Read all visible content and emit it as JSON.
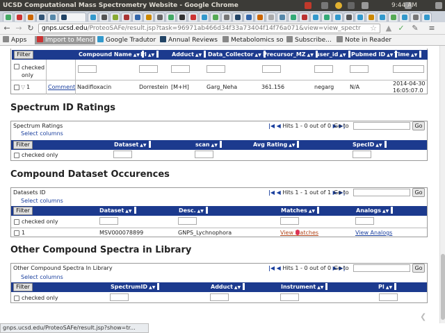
{
  "window": {
    "title": "UCSD Computational Mass Spectrometry Website - Google Chrome",
    "clock": "9:44 AM"
  },
  "browser": {
    "url_host": "gnps.ucsd.edu",
    "url_path": "/ProteoSAFe/result.jsp?task=96971ab466d34f33a73404f14f76a071&view=view_spectr",
    "bookmarks": [
      "Apps",
      "Import to Mend",
      "Google Tradutor",
      "Annual Reviews",
      "Metabolomics so",
      "Subscribe...",
      "Note in Reader"
    ],
    "status_url": "gnps.ucsd.edu/ProteoSAFe/result.jsp?show=tr..."
  },
  "top_table": {
    "filter_label": "Filter",
    "checked_only": "checked only",
    "headers": [
      "Compound Name",
      "PI",
      "Adduct",
      "Data_Collector",
      "Precursor_MZ",
      "user_id",
      "Pubmed ID",
      "Time"
    ],
    "row": {
      "index": "1",
      "comment": "Comment",
      "compound": "Nadifloxacin",
      "pi": "Dorrestein",
      "adduct": "[M+H]",
      "collector": "Garg_Neha",
      "precursor": "361.156",
      "user": "negarg",
      "pubmed": "N/A",
      "time_date": "2014-04-30",
      "time_clock": "16:05:07.0"
    }
  },
  "spectrum_ratings": {
    "heading": "Spectrum ID Ratings",
    "panel_title": "Spectrum Ratings",
    "select_columns": "Select columns",
    "hits": "Hits 1 - 0 out of 0",
    "goto_label": "Go to",
    "go": "Go",
    "filter_label": "Filter",
    "checked_only": "checked only",
    "headers": [
      "Dataset",
      "scan",
      "Avg Rating",
      "SpecID"
    ]
  },
  "compound_dataset": {
    "heading": "Compound Dataset Occurences",
    "panel_title": "Datasets ID",
    "select_columns": "Select columns",
    "hits": "Hits 1 - 1 out of 1",
    "goto_label": "Go to",
    "go": "Go",
    "filter_label": "Filter",
    "checked_only": "checked only",
    "headers": [
      "Dataset",
      "Desc.",
      "Matches",
      "Analogs"
    ],
    "row": {
      "index": "1",
      "dataset": "MSV000078899",
      "desc": "GNPS_Lychnophora",
      "matches": "View Matches",
      "analogs": "View Analogs"
    }
  },
  "other_spectra": {
    "heading": "Other Compound Spectra in Library",
    "panel_title": "Other Compound Spectra In Library",
    "select_columns": "Select columns",
    "hits": "Hits 1 - 0 out of 0",
    "goto_label": "Go to",
    "go": "Go",
    "filter_label": "Filter",
    "checked_only": "checked only",
    "headers": [
      "SpectrumID",
      "Adduct",
      "Instrument",
      "PI"
    ]
  }
}
